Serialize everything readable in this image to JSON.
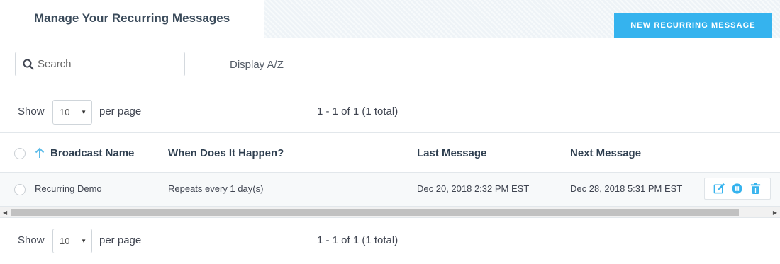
{
  "header": {
    "title": "Manage Your Recurring Messages",
    "new_button": "New Recurring Message"
  },
  "toolbar": {
    "search_placeholder": "Search",
    "search_value": "",
    "display_sort": "Display A/Z"
  },
  "pagination": {
    "show_label": "Show",
    "per_page_value": "10",
    "per_page_label": "per page",
    "range_text": "1 - 1 of 1 (1 total)"
  },
  "table": {
    "columns": [
      "Broadcast Name",
      "When Does It Happen?",
      "Last Message",
      "Next Message"
    ],
    "rows": [
      {
        "name": "Recurring Demo",
        "when": "Repeats every 1 day(s)",
        "last": "Dec 20, 2018 2:32 PM EST",
        "next": "Dec 28, 2018 5:31 PM EST"
      }
    ],
    "row_actions": [
      "edit-icon",
      "pause-icon",
      "trash-icon"
    ]
  },
  "colors": {
    "accent": "#35b3ee",
    "heading": "#2f3f50",
    "row_bg": "#f7f9fa"
  }
}
